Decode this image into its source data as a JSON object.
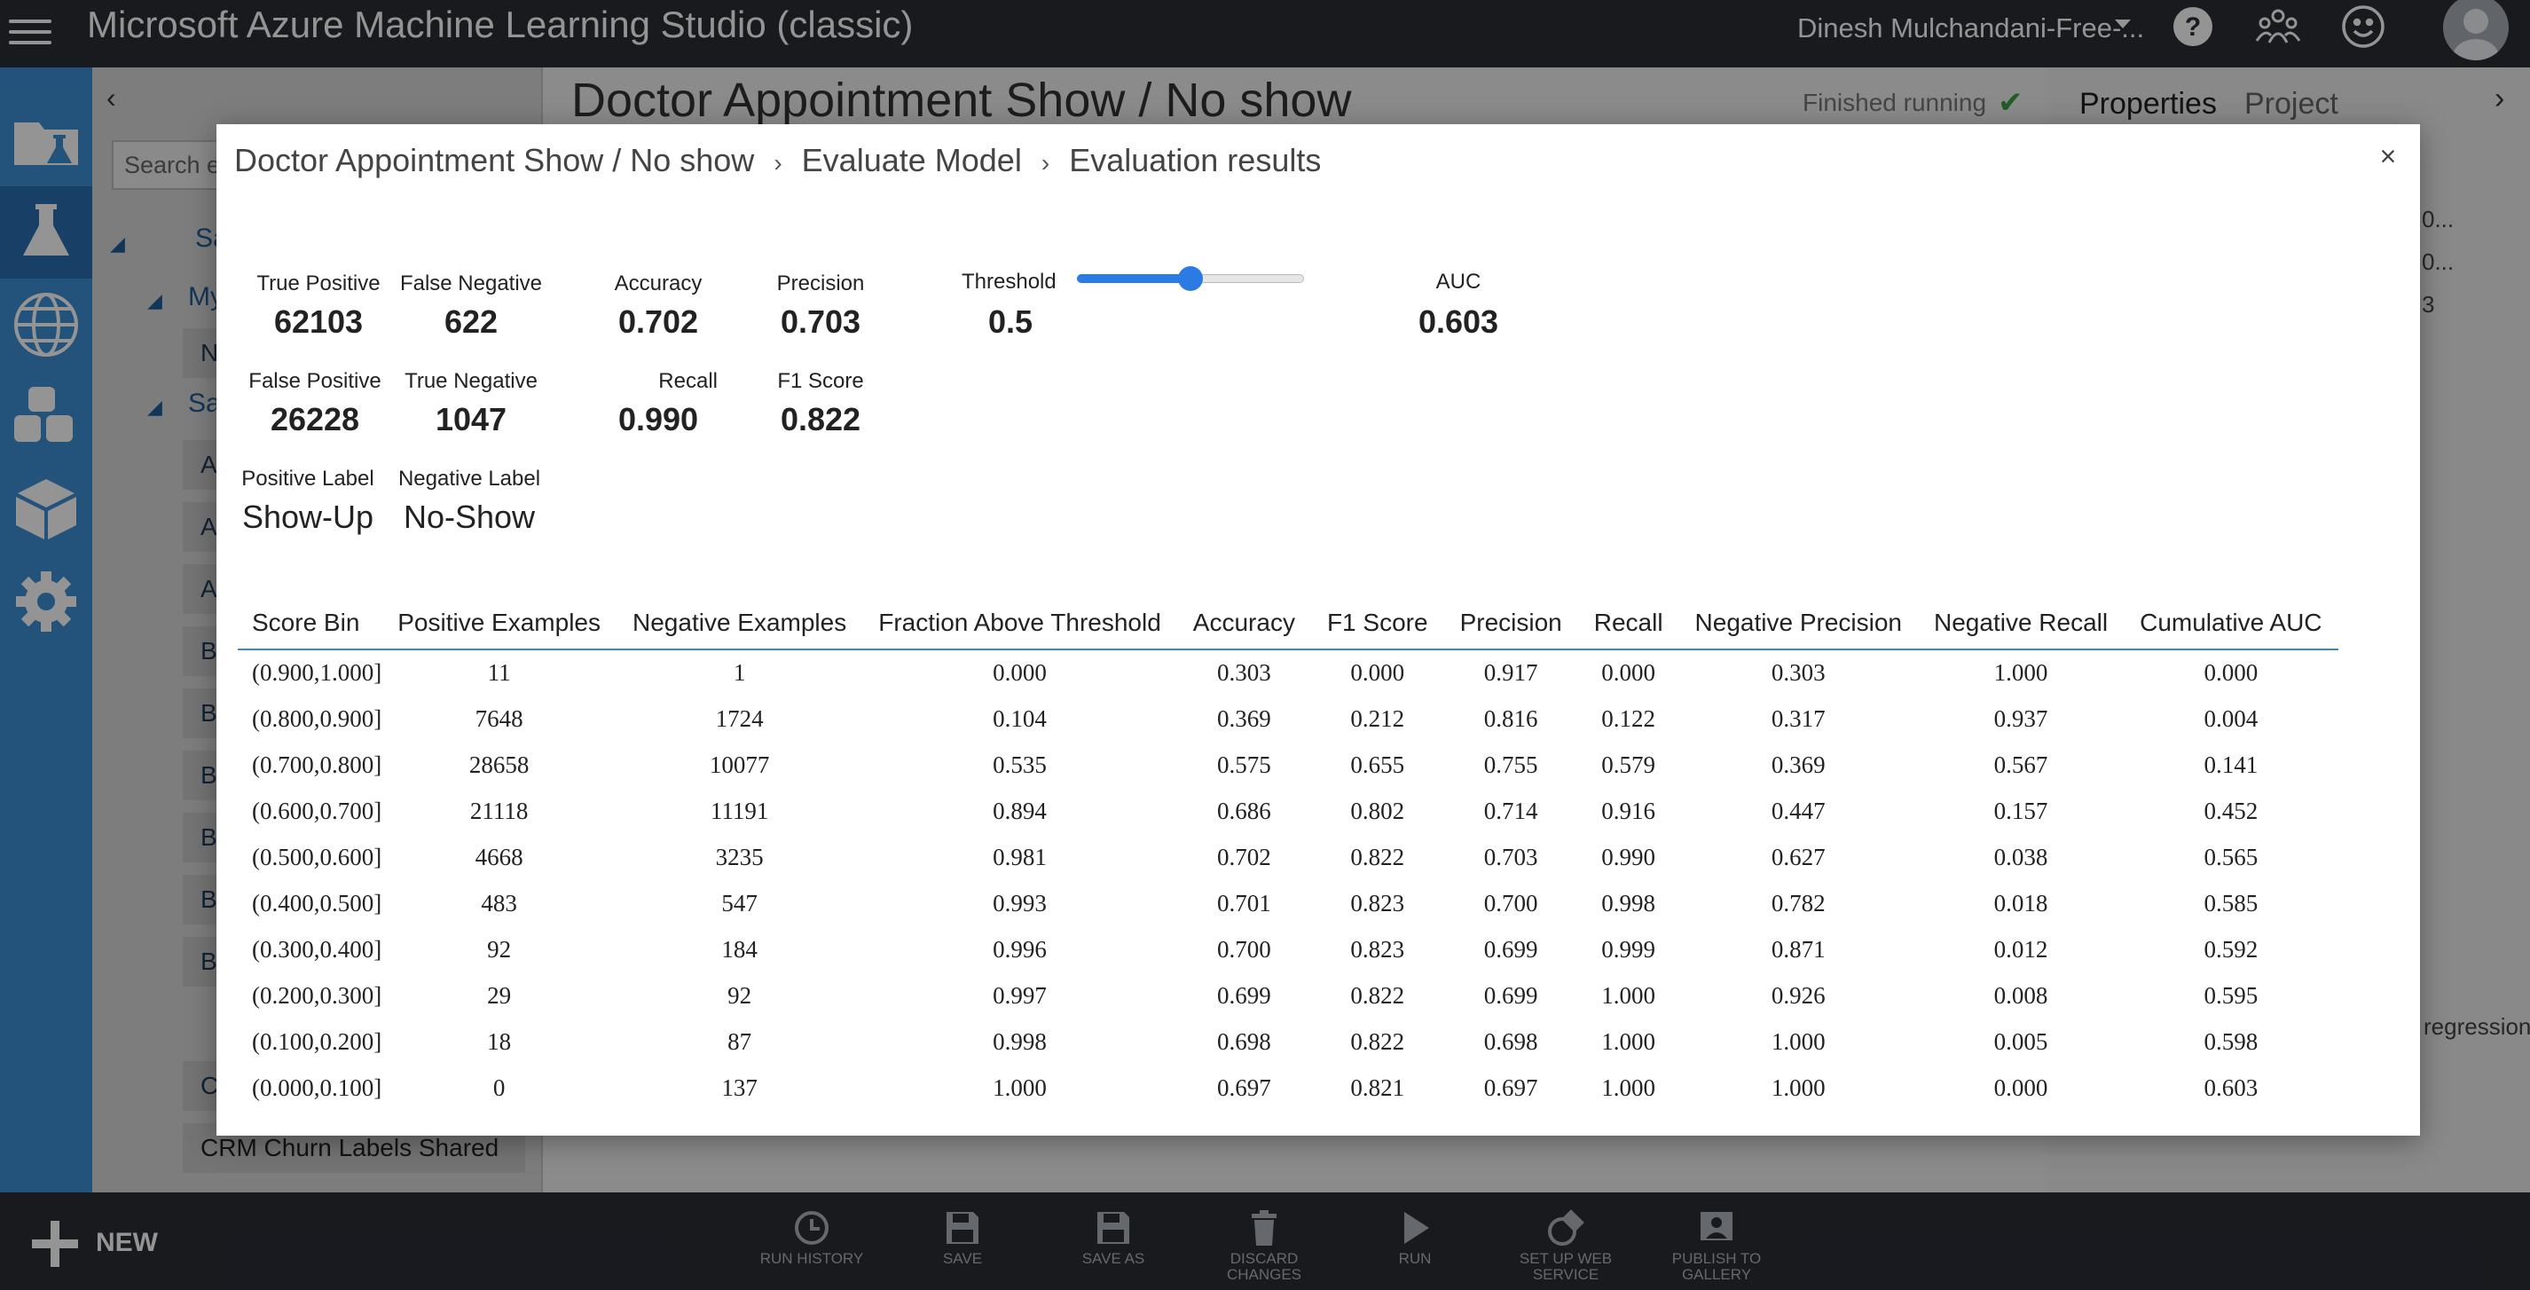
{
  "app": {
    "title": "Microsoft Azure Machine Learning Studio (classic)",
    "user_name": "Dinesh Mulchandani-Free-..."
  },
  "icons": {
    "menu": "hamburger-menu-icon",
    "help": "help-icon",
    "community": "community-icon",
    "feedback": "smiley-icon",
    "avatar": "user-avatar-icon"
  },
  "left_rail": [
    "projects-icon",
    "experiments-icon",
    "web-services-icon",
    "datasets-icon",
    "trained-models-icon",
    "settings-icon"
  ],
  "tree": {
    "search_placeholder": "Search ex",
    "head_saved": "Sa",
    "head_my": "My",
    "item_n": "N",
    "head_samples": "Sa",
    "rows": [
      "A",
      "A",
      "A",
      "B",
      "B",
      "B",
      "B",
      "B",
      "B",
      "C"
    ],
    "crm_row": "CRM Churn Labels Shared"
  },
  "canvas": {
    "experiment_title": "Doctor Appointment Show / No show",
    "status": "Finished running"
  },
  "properties": {
    "tab_properties": "Properties",
    "tab_project": "Project",
    "fragments": [
      "0...",
      "0...",
      "3",
      "regression"
    ]
  },
  "toolbar": {
    "new_label": "NEW",
    "buttons": [
      {
        "label": "RUN HISTORY",
        "icon": "clock-icon"
      },
      {
        "label": "SAVE",
        "icon": "save-icon"
      },
      {
        "label": "SAVE AS",
        "icon": "save-as-icon"
      },
      {
        "label": "DISCARD CHANGES",
        "icon": "trash-icon"
      },
      {
        "label": "RUN",
        "icon": "play-icon"
      },
      {
        "label": "SET UP WEB SERVICE",
        "icon": "web-service-icon"
      },
      {
        "label": "PUBLISH TO GALLERY",
        "icon": "publish-icon"
      }
    ]
  },
  "modal": {
    "breadcrumbs": [
      "Doctor Appointment Show / No show",
      "Evaluate Model",
      "Evaluation results"
    ],
    "close": "×",
    "metrics": {
      "true_positive": {
        "label": "True Positive",
        "value": "62103"
      },
      "false_negative": {
        "label": "False Negative",
        "value": "622"
      },
      "accuracy": {
        "label": "Accuracy",
        "value": "0.702"
      },
      "precision": {
        "label": "Precision",
        "value": "0.703"
      },
      "false_positive": {
        "label": "False Positive",
        "value": "26228"
      },
      "true_negative": {
        "label": "True Negative",
        "value": "1047"
      },
      "recall": {
        "label": "Recall",
        "value": "0.990"
      },
      "f1_score": {
        "label": "F1 Score",
        "value": "0.822"
      },
      "positive_label": {
        "label": "Positive Label",
        "value": "Show-Up"
      },
      "negative_label": {
        "label": "Negative Label",
        "value": "No-Show"
      }
    },
    "threshold": {
      "label": "Threshold",
      "value": "0.5",
      "fraction": 0.5
    },
    "auc": {
      "label": "AUC",
      "value": "0.603"
    },
    "table": {
      "columns": [
        "Score Bin",
        "Positive Examples",
        "Negative Examples",
        "Fraction Above Threshold",
        "Accuracy",
        "F1 Score",
        "Precision",
        "Recall",
        "Negative Precision",
        "Negative Recall",
        "Cumulative AUC"
      ],
      "rows": [
        [
          "(0.900,1.000]",
          "11",
          "1",
          "0.000",
          "0.303",
          "0.000",
          "0.917",
          "0.000",
          "0.303",
          "1.000",
          "0.000"
        ],
        [
          "(0.800,0.900]",
          "7648",
          "1724",
          "0.104",
          "0.369",
          "0.212",
          "0.816",
          "0.122",
          "0.317",
          "0.937",
          "0.004"
        ],
        [
          "(0.700,0.800]",
          "28658",
          "10077",
          "0.535",
          "0.575",
          "0.655",
          "0.755",
          "0.579",
          "0.369",
          "0.567",
          "0.141"
        ],
        [
          "(0.600,0.700]",
          "21118",
          "11191",
          "0.894",
          "0.686",
          "0.802",
          "0.714",
          "0.916",
          "0.447",
          "0.157",
          "0.452"
        ],
        [
          "(0.500,0.600]",
          "4668",
          "3235",
          "0.981",
          "0.702",
          "0.822",
          "0.703",
          "0.990",
          "0.627",
          "0.038",
          "0.565"
        ],
        [
          "(0.400,0.500]",
          "483",
          "547",
          "0.993",
          "0.701",
          "0.823",
          "0.700",
          "0.998",
          "0.782",
          "0.018",
          "0.585"
        ],
        [
          "(0.300,0.400]",
          "92",
          "184",
          "0.996",
          "0.700",
          "0.823",
          "0.699",
          "0.999",
          "0.871",
          "0.012",
          "0.592"
        ],
        [
          "(0.200,0.300]",
          "29",
          "92",
          "0.997",
          "0.699",
          "0.822",
          "0.699",
          "1.000",
          "0.926",
          "0.008",
          "0.595"
        ],
        [
          "(0.100,0.200]",
          "18",
          "87",
          "0.998",
          "0.698",
          "0.822",
          "0.698",
          "1.000",
          "1.000",
          "0.005",
          "0.598"
        ],
        [
          "(0.000,0.100]",
          "0",
          "137",
          "1.000",
          "0.697",
          "0.821",
          "0.697",
          "1.000",
          "1.000",
          "0.000",
          "0.603"
        ]
      ]
    }
  },
  "colors": {
    "top_bar": "#2b2d35",
    "left_rail": "#3d8fd3",
    "accent": "#2c7be5",
    "table_rule": "#3b87c9",
    "status_check": "#3ba146"
  }
}
